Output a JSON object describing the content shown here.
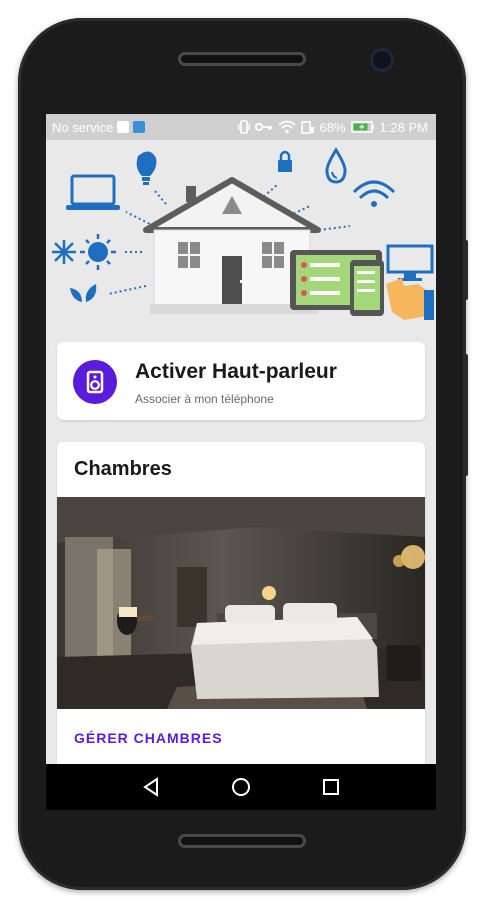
{
  "status_bar": {
    "carrier": "No service",
    "battery": "68%",
    "time": "1:28 PM"
  },
  "speaker_card": {
    "title": "Activer Haut-parleur",
    "subtitle": "Associer à mon téléphone",
    "icon": "speaker-icon"
  },
  "rooms_card": {
    "title": "Chambres",
    "action": "GÉRER CHAMBRES"
  },
  "nav_bar": {
    "back": "back-icon",
    "home": "home-icon",
    "recents": "recents-icon"
  },
  "colors": {
    "accent": "#5b1bdc",
    "screen_bg": "#e9e9e9"
  }
}
